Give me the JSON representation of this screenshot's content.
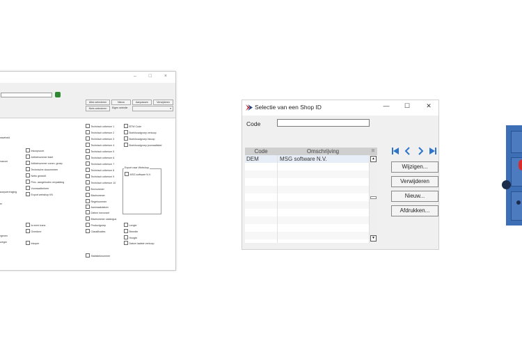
{
  "background_window": {
    "controls": "–  □  ×",
    "toolbar_buttons": [
      "Alles selecteren",
      "Nieuw",
      "Aanpassen",
      "Verwijderen",
      "Niets selecteren"
    ],
    "eigen_selectie_label": "Eigen selectie",
    "col_left": [
      "waveheid",
      "erancer",
      "auwpvereniging",
      "ier",
      "egenen",
      "ozeger"
    ],
    "col_mid": [
      "Inkoopsoort",
      "Artikelnummer klant",
      "Artikelnummer comm. groep",
      "Technische documenten",
      "Netto gewicht",
      "Perc. aangeboden verpakking",
      "Voorraadbeheer",
      "Export webshop t/N",
      "Is merk trans",
      "Overdore",
      "Inkoper"
    ],
    "col_right1": [
      "Technisch criterium 1",
      "Technisch criterium 2",
      "Technisch criterium 3",
      "Technisch criterium 4",
      "Technisch criterium 5",
      "Technisch criterium 6",
      "Technisch criterium 7",
      "Technisch criterium 8",
      "Technisch criterium 9",
      "Technisch criterium 10",
      "Boxnummer",
      "Bladnummer",
      "Regelnummer",
      "Aanmaakdatum",
      "Datum inzourant",
      "Bladnummer catalogus",
      "Productgroep",
      "Classificaties",
      "Statistieknummer"
    ],
    "col_right2": [
      "BTW Code",
      "Boekhoudgroep verkoop",
      "Boekhoudgroep inkoop",
      "Boekhoudgroep journaalfabel",
      "Lengte",
      "Breedte",
      "Hoogte",
      "Datum laatste verkoop"
    ],
    "export_group_label": "Export naar Webshop",
    "export_item": "MSG software N.V."
  },
  "dialog": {
    "title": "Selectie van een Shop ID",
    "controls": {
      "minimize": "—",
      "maximize": "☐",
      "close": "✕"
    },
    "code_label": "Code",
    "code_value": "",
    "grid": {
      "headers": {
        "code": "Code",
        "omschrijving": "Omschrijving"
      },
      "rows": [
        {
          "code": "DEM",
          "omschrijving": "MSG software N.V."
        }
      ]
    },
    "nav": {
      "first": "⏮",
      "prev": "‹",
      "next": "›",
      "last": "⏭"
    },
    "buttons": {
      "edit": "Wijzigen...",
      "delete": "Verwijderen",
      "new": "Nieuw...",
      "print": "Afdrukken..."
    }
  },
  "colors": {
    "accent": "#2e74c8",
    "panel_blue": "#3d6fb6",
    "red_dot": "#d82c2c",
    "dark_dot": "#1b2d4a"
  }
}
